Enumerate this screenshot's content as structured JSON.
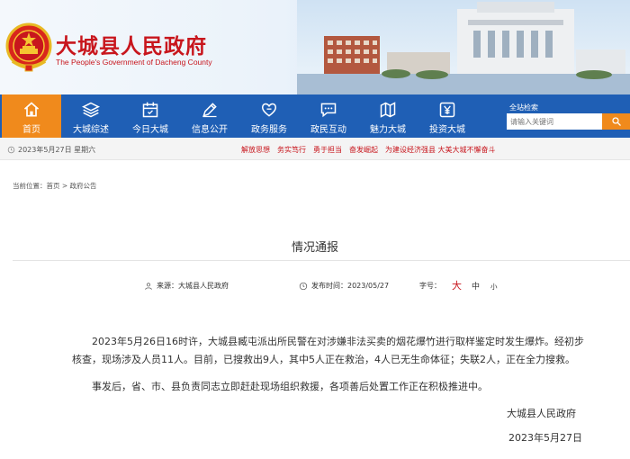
{
  "header": {
    "title": "大城县人民政府",
    "subtitle": "The People's Government of Dacheng County"
  },
  "search": {
    "label": "全站检索",
    "placeholder": "请输入关键词",
    "button_icon": "search-icon"
  },
  "nav": {
    "items": [
      {
        "label": "首页",
        "icon": "home-icon",
        "active": true
      },
      {
        "label": "大城综述",
        "icon": "layers-icon"
      },
      {
        "label": "今日大城",
        "icon": "calendar-icon"
      },
      {
        "label": "信息公开",
        "icon": "pen-icon"
      },
      {
        "label": "政务服务",
        "icon": "heart-icon"
      },
      {
        "label": "政民互动",
        "icon": "chat-icon"
      },
      {
        "label": "魅力大城",
        "icon": "map-icon"
      },
      {
        "label": "投资大城",
        "icon": "yuan-icon"
      }
    ]
  },
  "infobar": {
    "date": "2023年5月27日 星期六",
    "slogans": [
      "解放思想",
      "务实笃行",
      "勇于担当",
      "奋发崛起",
      "为建设经济强县 大美大城不懈奋斗"
    ]
  },
  "breadcrumb": "当前位置：首页 > 政府公告",
  "article": {
    "title": "情况通报",
    "source_label": "来源：大城县人民政府",
    "publish_label": "发布时间：2023/05/27",
    "font_size_label": "字号：",
    "size_large": "大",
    "size_medium": "中",
    "size_small": "小",
    "paragraph1": "2023年5月26日16时许，大城县臧屯派出所民警在对涉嫌非法买卖的烟花爆竹进行取样鉴定时发生爆炸。经初步核查，现场涉及人员11人。目前，已搜救出9人，其中5人正在救治，4人已无生命体征；失联2人，正在全力搜救。",
    "paragraph2": "事发后，省、市、县负责同志立即赶赴现场组织救援，各项善后处置工作正在积极推进中。",
    "signature": "大城县人民政府",
    "sign_date": "2023年5月27日"
  }
}
